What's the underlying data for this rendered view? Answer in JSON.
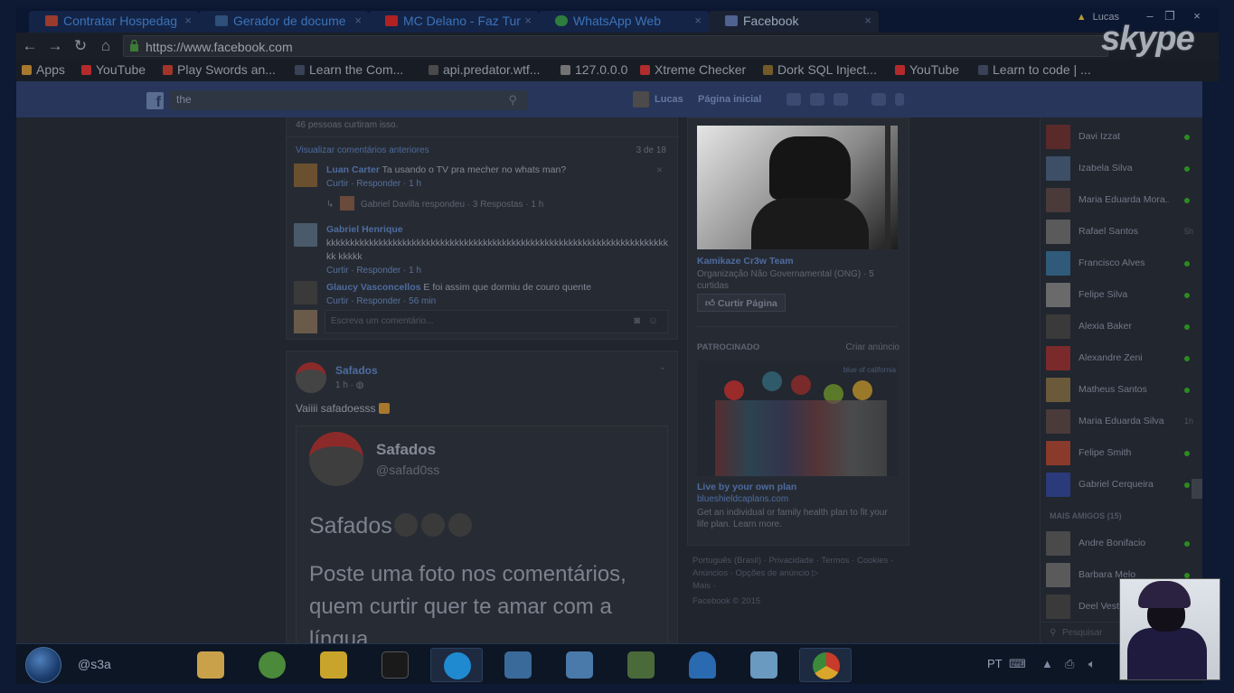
{
  "browser": {
    "tabs": [
      {
        "title": "Contratar Hospedag",
        "favicon_color": "#9b3b2e"
      },
      {
        "title": "Gerador de docume",
        "favicon_color": "#2e4f7a"
      },
      {
        "title": "MC Delano - Faz Tur",
        "favicon_color": "#b02222"
      },
      {
        "title": "WhatsApp Web",
        "favicon_color": "#2f7d3d"
      },
      {
        "title": "Facebook",
        "favicon_color": "#4f6290"
      }
    ],
    "user": "Lucas",
    "close_glyph": "×",
    "url": "https://www.facebook.com",
    "bookmarks": [
      {
        "label": "Apps",
        "color": "#a8782d"
      },
      {
        "label": "YouTube",
        "color": "#b42a2a"
      },
      {
        "label": "Play Swords an...",
        "color": "#a3342a"
      },
      {
        "label": "Learn the Com...",
        "color": "#394257"
      },
      {
        "label": "api.predator.wtf...",
        "color": "#4a4a4a"
      },
      {
        "label": "127.0.0.0",
        "color": "#737373"
      },
      {
        "label": "Xtreme Checker",
        "color": "#b12c2c"
      },
      {
        "label": "Dork SQL Inject...",
        "color": "#735a28"
      },
      {
        "label": "YouTube",
        "color": "#b42a2a"
      },
      {
        "label": "Learn to code | ...",
        "color": "#394257"
      }
    ],
    "overlay_logo": "skype"
  },
  "facebook": {
    "search_value": "the",
    "nav_user": "Lucas",
    "nav_home": "Página inicial"
  },
  "feed": {
    "likes_text": "46 pessoas curtiram isso.",
    "prev_comments": "Visualizar comentários anteriores",
    "comment_count": "3 de 18",
    "comments": [
      {
        "name": "Luan Carter",
        "text": "Ta usando o TV pra mecher no whats man?",
        "acts": "Curtir · Responder · 1 h",
        "avatar_color": "#6b5030"
      },
      {
        "name": "Gabriel Henrique",
        "text": "kkkkkkkkkkkkkkkkkkkkkkkkkkkkkkkkkkkkkkkkkkkkkkkkkkkkkkkkkkkkkkkkkkkkkkkkkk kkkkk",
        "acts": "Curtir · Responder · 1 h",
        "avatar_color": "#4a5a6a"
      },
      {
        "name": "Glaucy Vasconcellos",
        "text": "E foi assim que dormiu de couro quente",
        "acts": "Curtir · Responder · 56 min",
        "avatar_color": "#3a3a3a"
      }
    ],
    "reply_text": "Gabriel Davilla respondeu · 3 Respostas · 1 h",
    "write_comment_placeholder": "Escreva um comentário...",
    "post": {
      "author": "Safados",
      "time": "1 h · ",
      "text": "Vaiiii safadoesss",
      "embed": {
        "name": "Safados",
        "handle": "@safad0ss",
        "title": "Safados",
        "body": "Poste uma foto nos comentários, quem curtir quer te amar com a língua"
      }
    }
  },
  "middle": {
    "page_name": "Kamikaze Cr3w Team",
    "page_category": "Organização Não Governamental (ONG) · 5 curtidas",
    "like_page": "Curtir Página",
    "sponsored": "PATROCINADO",
    "create_ad": "Criar anúncio",
    "ad_brand": "blue of california",
    "ad_title": "Live by your own plan",
    "ad_domain": "blueshieldcaplans.com",
    "ad_text": "Get an individual or family health plan to fit your life plan. Learn more.",
    "footer_line1": "Português (Brasil) · Privacidade · Termos · Cookies · Anúncios · Opções de anúncio",
    "footer_line2": "Mais ·",
    "footer_copy": "Facebook © 2015"
  },
  "chat": {
    "friends": [
      {
        "name": "Davi Izzat",
        "status": "online",
        "color": "#5a2a2a"
      },
      {
        "name": "Izabela Silva",
        "status": "online",
        "color": "#3c4f66"
      },
      {
        "name": "Maria Eduarda Mora...",
        "status": "online",
        "color": "#4a3a3a"
      },
      {
        "name": "Rafael Santos",
        "status": "5h",
        "color": "#5a5a5a"
      },
      {
        "name": "Francisco Alves",
        "status": "online",
        "color": "#2f5a7a"
      },
      {
        "name": "Felipe Silva",
        "status": "online",
        "color": "#6a6a6a"
      },
      {
        "name": "Alexia Baker",
        "status": "online",
        "color": "#3a3a3a"
      },
      {
        "name": "Alexandre Zeni",
        "status": "online",
        "color": "#7a2a2a"
      },
      {
        "name": "Matheus Santos",
        "status": "online",
        "color": "#6a5a3a"
      },
      {
        "name": "Maria Eduarda Silva",
        "status": "1h",
        "color": "#4a3a3a"
      },
      {
        "name": "Felipe Smith",
        "status": "online",
        "color": "#8a3a2a"
      },
      {
        "name": "Gabriel Cerqueira",
        "status": "online",
        "color": "#2a3a7a"
      }
    ],
    "more_friends": "MAIS AMIGOS (15)",
    "more": [
      {
        "name": "Andre Bonifacio",
        "status": "online",
        "color": "#4a4a4a"
      },
      {
        "name": "Barbara Melo",
        "status": "online",
        "color": "#5a5a5a"
      },
      {
        "name": "Deel Vest",
        "status": "online",
        "color": "#3a3a3a"
      }
    ],
    "search_placeholder": "Pesquisar"
  },
  "taskbar": {
    "user": "@s3a",
    "apps": [
      {
        "name": "explorer",
        "color": "#c9a14a"
      },
      {
        "name": "globe",
        "color": "#4a8a3a"
      },
      {
        "name": "folder-share",
        "color": "#c9a42a"
      },
      {
        "name": "cmd",
        "color": "#1a1a1a"
      },
      {
        "name": "skype",
        "color": "#1f8ad0"
      },
      {
        "name": "network",
        "color": "#3a6a9a"
      },
      {
        "name": "network2",
        "color": "#4a7aaa"
      },
      {
        "name": "keys",
        "color": "#4a6a3a"
      },
      {
        "name": "wireshark",
        "color": "#2a6ab0"
      },
      {
        "name": "notepad",
        "color": "#6a9abf"
      },
      {
        "name": "chrome",
        "color": "#c83a2a"
      }
    ],
    "lang": "PT"
  }
}
